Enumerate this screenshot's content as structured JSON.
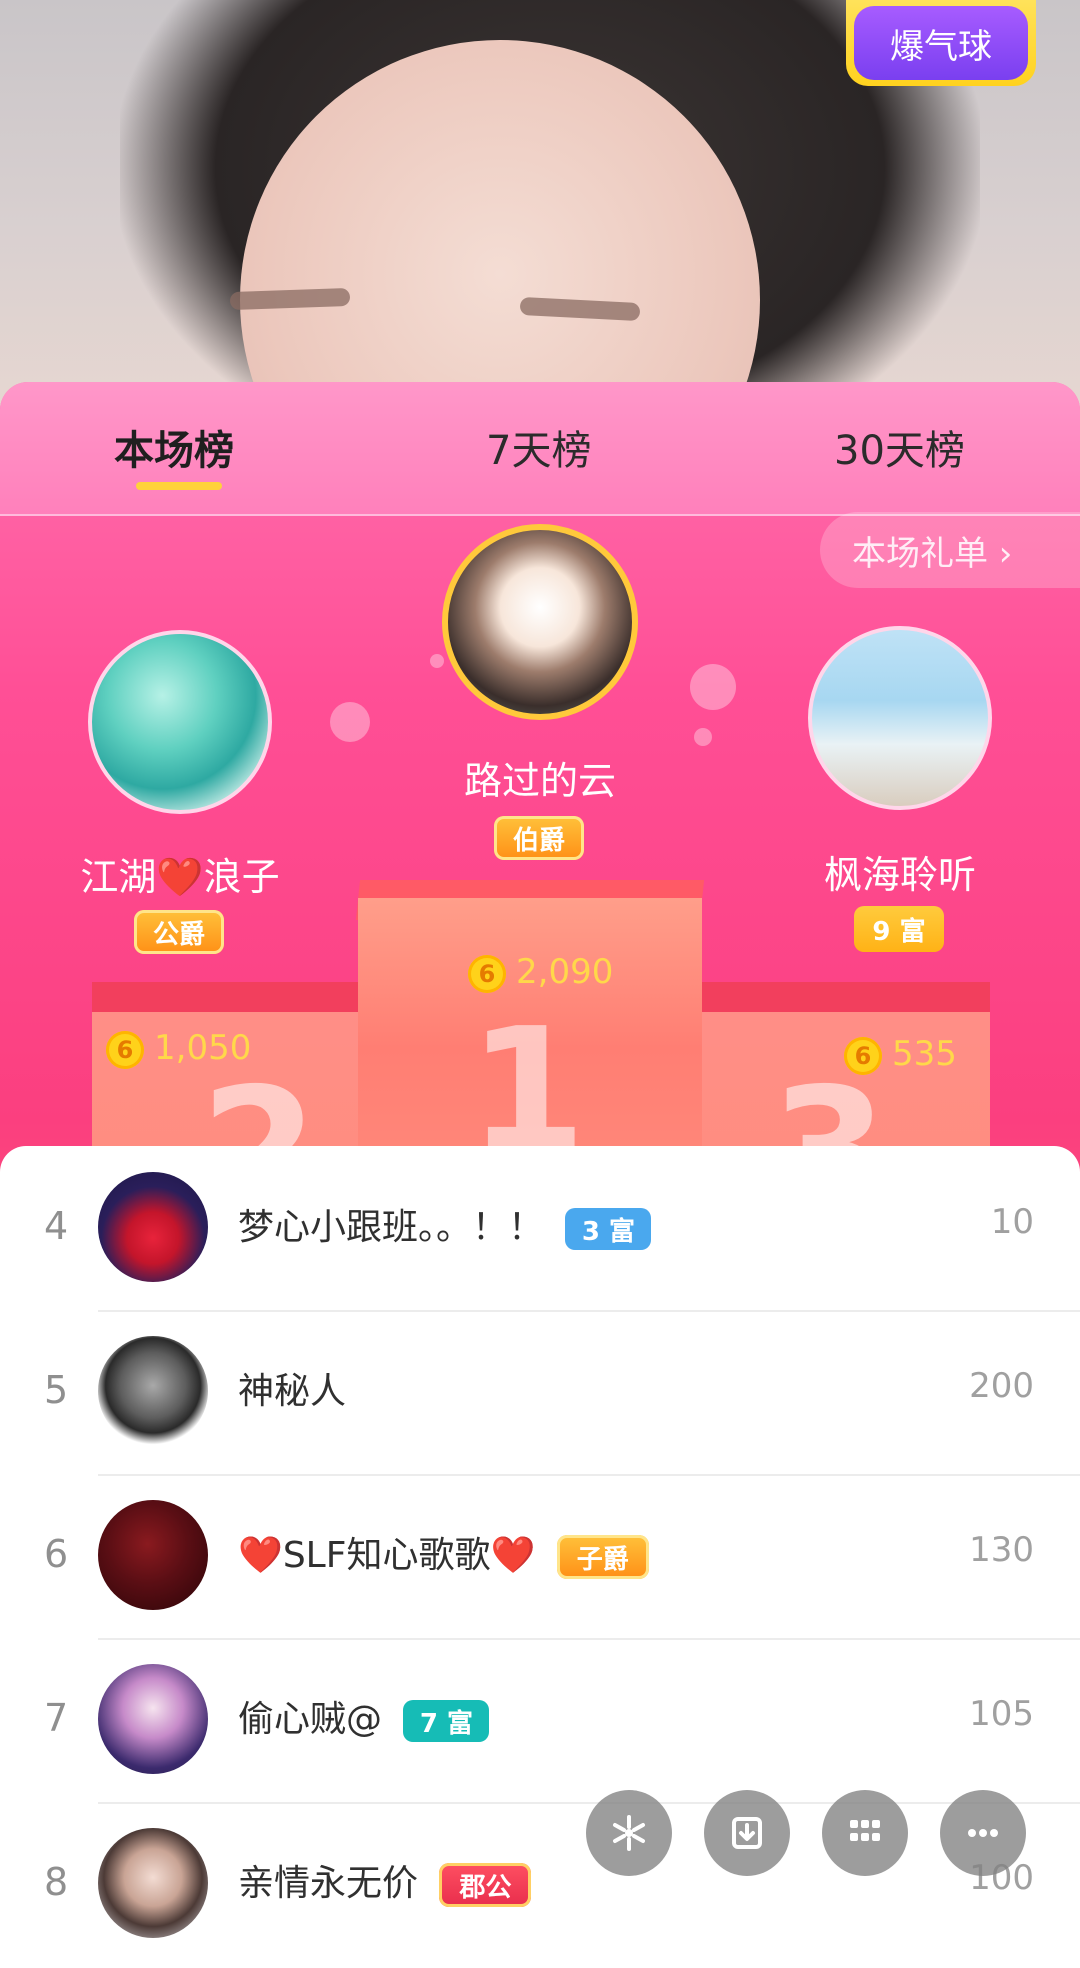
{
  "video": {
    "boom_label": "爆气球"
  },
  "tabs": [
    {
      "label": "本场榜",
      "active": true
    },
    {
      "label": "7天榜",
      "active": false
    },
    {
      "label": "30天榜",
      "active": false
    }
  ],
  "gift_list_label": "本场礼单 ›",
  "podium": {
    "first": {
      "rank": "1",
      "name": "路过的云",
      "badge": "伯爵",
      "score": "2,090"
    },
    "second": {
      "rank": "2",
      "name": "江湖❤️浪子",
      "badge": "公爵",
      "score": "1,050"
    },
    "third": {
      "rank": "3",
      "name": "枫海聆听",
      "badge": "9 富",
      "score": "535"
    }
  },
  "rank_list": [
    {
      "rank": "4",
      "name": "梦心小跟班。。！！",
      "badge": "3 富",
      "badge_color": "#4aa8ee",
      "value": "10"
    },
    {
      "rank": "5",
      "name": "神秘人",
      "badge": "",
      "badge_color": "",
      "value": "200"
    },
    {
      "rank": "6",
      "name": "❤️SLF知心歌歌❤️",
      "badge": "子爵",
      "badge_color": "#ffb216",
      "value": "130"
    },
    {
      "rank": "7",
      "name": "偷心贼@",
      "badge": "7 富",
      "badge_color": "#16bcb6",
      "value": "105"
    },
    {
      "rank": "8",
      "name": "亲情永无价",
      "badge": "郡公",
      "badge_color": "#e82d4c",
      "value": "100"
    }
  ],
  "coin_glyph": "6",
  "fab_icons": [
    "flower-icon",
    "download-icon",
    "grid-icon",
    "more-icon"
  ]
}
